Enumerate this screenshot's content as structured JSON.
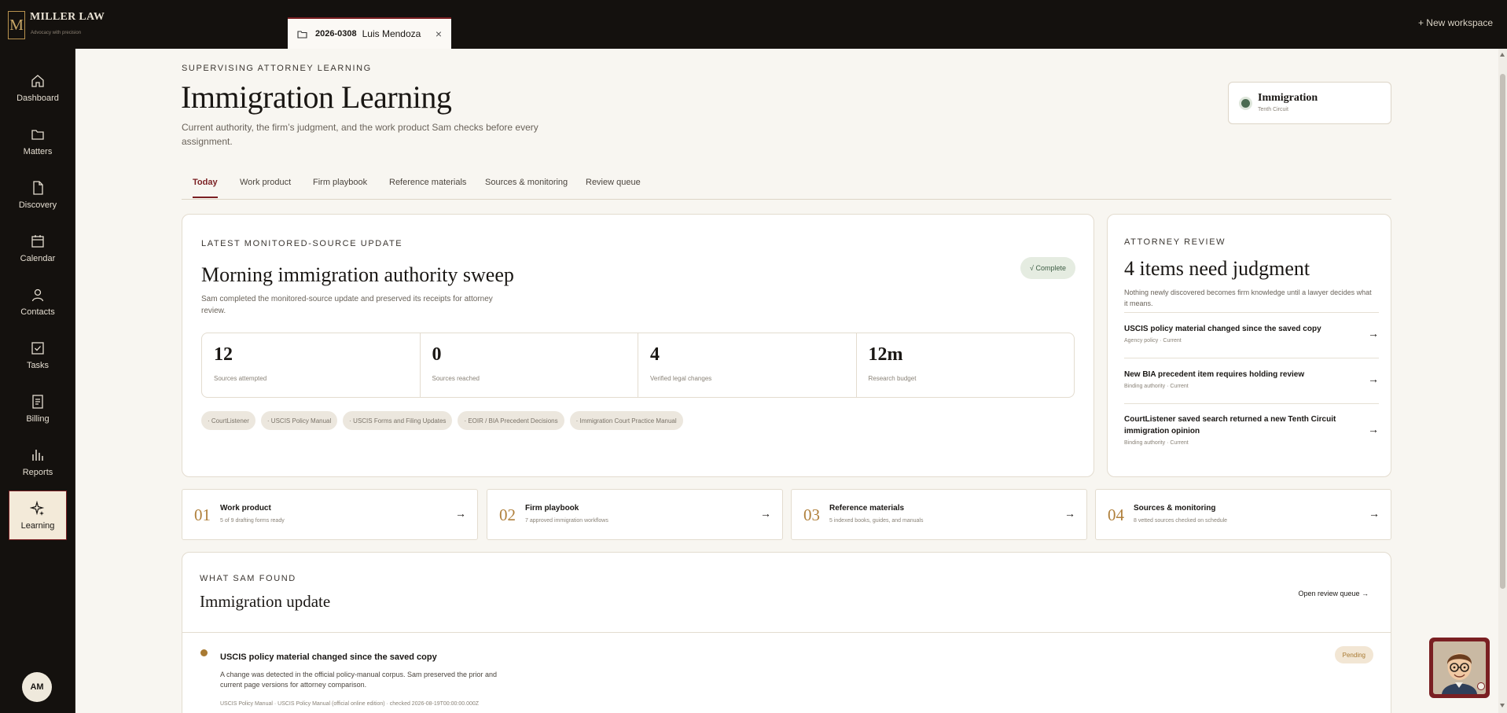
{
  "app": {
    "brand_name": "MILLER LAW",
    "brand_tagline": "Advocacy with precision",
    "brand_monogram": "M",
    "new_workspace_label": "+ New workspace"
  },
  "matter_tab": {
    "code": "2026-0308",
    "client": "Luis Mendoza",
    "close_glyph": "×"
  },
  "sidebar": {
    "items": [
      {
        "label": "Dashboard",
        "icon": "home-icon"
      },
      {
        "label": "Matters",
        "icon": "folder-icon"
      },
      {
        "label": "Discovery",
        "icon": "document-icon"
      },
      {
        "label": "Calendar",
        "icon": "calendar-icon"
      },
      {
        "label": "Contacts",
        "icon": "person-icon"
      },
      {
        "label": "Tasks",
        "icon": "checkbox-icon"
      },
      {
        "label": "Billing",
        "icon": "invoice-icon"
      },
      {
        "label": "Reports",
        "icon": "bar-chart-icon"
      },
      {
        "label": "Learning",
        "icon": "sparkle-icon",
        "active": true
      }
    ],
    "user_initials": "AM"
  },
  "header": {
    "eyebrow": "SUPERVISING ATTORNEY LEARNING",
    "title": "Immigration Learning",
    "subtitle": "Current authority, the firm’s judgment, and the work product Sam checks before every assignment.",
    "practice_area": "Immigration",
    "circuit": "Tenth Circuit",
    "status_color": "#4a6b50"
  },
  "tabs": [
    {
      "label": "Today",
      "active": true
    },
    {
      "label": "Work product"
    },
    {
      "label": "Firm playbook"
    },
    {
      "label": "Reference materials"
    },
    {
      "label": "Sources & monitoring"
    },
    {
      "label": "Review queue"
    }
  ],
  "update_card": {
    "eyebrow": "LATEST MONITORED-SOURCE UPDATE",
    "title": "Morning immigration authority sweep",
    "description": "Sam completed the monitored-source update and preserved its receipts for attorney review.",
    "status": "√ Complete",
    "stats": [
      {
        "value": "12",
        "label": "Sources attempted"
      },
      {
        "value": "0",
        "label": "Sources reached"
      },
      {
        "value": "4",
        "label": "Verified legal changes"
      },
      {
        "value": "12m",
        "label": "Research budget"
      }
    ],
    "sources": [
      "· CourtListener",
      "· USCIS Policy Manual",
      "· USCIS Forms and Filing Updates",
      "· EOIR / BIA Precedent Decisions",
      "· Immigration Court Practice Manual"
    ]
  },
  "attorney_review": {
    "eyebrow": "ATTORNEY REVIEW",
    "title": "4 items need judgment",
    "description": "Nothing newly discovered becomes firm knowledge until a lawyer decides what it means.",
    "items": [
      {
        "title": "USCIS policy material changed since the saved copy",
        "meta": "Agency policy · Current"
      },
      {
        "title": "New BIA precedent item requires holding review",
        "meta": "Binding authority · Current"
      },
      {
        "title": "CourtListener saved search returned a new Tenth Circuit immigration opinion",
        "meta": "Binding authority · Current"
      }
    ],
    "arrow": "→"
  },
  "modules": [
    {
      "num": "01",
      "title": "Work product",
      "sub": "5 of 9 drafting forms ready"
    },
    {
      "num": "02",
      "title": "Firm playbook",
      "sub": "7 approved immigration workflows"
    },
    {
      "num": "03",
      "title": "Reference materials",
      "sub": "5 indexed books, guides, and manuals"
    },
    {
      "num": "04",
      "title": "Sources & monitoring",
      "sub": "8 vetted sources checked on schedule"
    }
  ],
  "found": {
    "eyebrow": "WHAT SAM FOUND",
    "title": "Immigration update",
    "open_queue": "Open review queue →",
    "item": {
      "title": "USCIS policy material changed since the saved copy",
      "description": "A change was detected in the official policy-manual corpus. Sam preserved the prior and current page versions for attorney comparison.",
      "meta": "USCIS Policy Manual · USCIS Policy Manual (official online edition) · checked 2026-08-19T00:00:00.000Z",
      "status": "Pending"
    }
  },
  "colors": {
    "accent": "#7a1f22",
    "gold": "#b0803c",
    "sidebar_bg": "#14110e",
    "page_bg": "#f8f6f1"
  }
}
